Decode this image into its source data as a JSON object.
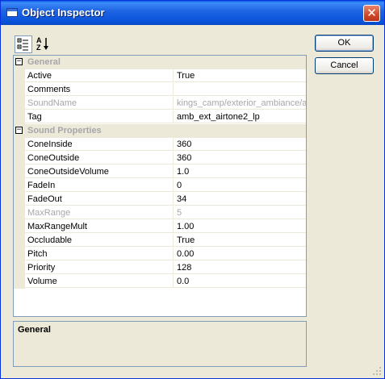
{
  "window": {
    "title": "Object Inspector"
  },
  "toolbar": {
    "categorized_icon": "categorized-icon",
    "alphabetical_icon": "sort-az-icon"
  },
  "buttons": {
    "ok": "OK",
    "cancel": "Cancel"
  },
  "colors": {
    "titlebar": "#0a5fe8",
    "disabled_text": "#a7a6aa",
    "grid_line": "#ece9d8",
    "face": "#ece9d8"
  },
  "categories": [
    {
      "name": "General",
      "collapse_symbol": "⊟",
      "properties": [
        {
          "name": "Active",
          "value": "True",
          "disabled": false
        },
        {
          "name": "Comments",
          "value": "",
          "disabled": false
        },
        {
          "name": "SoundName",
          "value": "kings_camp/exterior_ambiance/amb_",
          "disabled": true
        },
        {
          "name": "Tag",
          "value": "amb_ext_airtone2_lp",
          "disabled": false
        }
      ]
    },
    {
      "name": "Sound Properties",
      "collapse_symbol": "⊟",
      "properties": [
        {
          "name": "ConeInside",
          "value": "360",
          "disabled": false
        },
        {
          "name": "ConeOutside",
          "value": "360",
          "disabled": false
        },
        {
          "name": "ConeOutsideVolume",
          "value": "1.0",
          "disabled": false
        },
        {
          "name": "FadeIn",
          "value": "0",
          "disabled": false
        },
        {
          "name": "FadeOut",
          "value": "34",
          "disabled": false
        },
        {
          "name": "MaxRange",
          "value": "5",
          "disabled": true
        },
        {
          "name": "MaxRangeMult",
          "value": "1.00",
          "disabled": false
        },
        {
          "name": "Occludable",
          "value": "True",
          "disabled": false
        },
        {
          "name": "Pitch",
          "value": "0.00",
          "disabled": false
        },
        {
          "name": "Priority",
          "value": "128",
          "disabled": false
        },
        {
          "name": "Volume",
          "value": "0.0",
          "disabled": false
        }
      ]
    }
  ],
  "description": {
    "title": "General"
  }
}
